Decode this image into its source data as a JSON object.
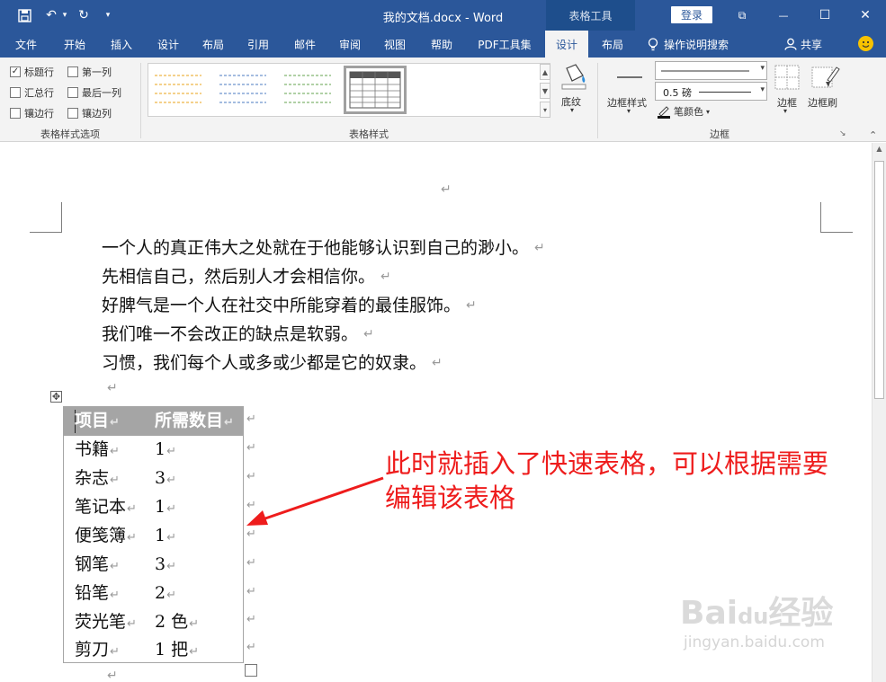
{
  "titlebar": {
    "title": "我的文档.docx - Word",
    "context_tab": "表格工具",
    "login": "登录",
    "undo_icon": "↶",
    "redo_icon": "↻",
    "qat_dropdown_icon": "▾",
    "minimize_icon": "—",
    "restore_icon": "☐",
    "close_icon": "✕",
    "ribbon_display_icon": "⧉"
  },
  "tabs": [
    "文件",
    "开始",
    "插入",
    "设计",
    "布局",
    "引用",
    "邮件",
    "审阅",
    "视图",
    "帮助",
    "PDF工具集",
    "设计",
    "布局"
  ],
  "active_tab_index": 11,
  "tell_me": "操作说明搜索",
  "share": "共享",
  "ribbon": {
    "style_options": {
      "label": "表格样式选项",
      "checkboxes": [
        {
          "label": "标题行",
          "checked": true
        },
        {
          "label": "第一列",
          "checked": false
        },
        {
          "label": "汇总行",
          "checked": false
        },
        {
          "label": "最后一列",
          "checked": false
        },
        {
          "label": "镶边行",
          "checked": false
        },
        {
          "label": "镶边列",
          "checked": false
        }
      ],
      "check_mark": "✓"
    },
    "table_styles": {
      "label": "表格样式",
      "shading": "底纹",
      "shading_arrow": "▾",
      "gallery_colors": [
        "#e8a317",
        "#4a78c2",
        "#63a34d",
        "#555555"
      ]
    },
    "borders": {
      "label": "边框",
      "border_styles": "边框样式",
      "border_styles_arrow": "▾",
      "line_weight": "0.5 磅",
      "pen_color": "笔颜色",
      "pen_color_arrow": "▾",
      "borders_btn": "边框",
      "borders_arrow": "▾",
      "border_painter": "边框刷",
      "dropdown_arrow": "▾",
      "launcher_icon": "↘"
    },
    "collapse_icon": "⌃"
  },
  "document": {
    "return_mark": "↵",
    "paragraphs": [
      "一个人的真正伟大之处就在于他能够认识到自己的渺小。",
      "先相信自己，然后别人才会相信你。",
      "好脾气是一个人在社交中所能穿着的最佳服饰。",
      "我们唯一不会改正的缺点是软弱。",
      "习惯，我们每个人或多或少都是它的奴隶。"
    ],
    "table_move_icon": "✥",
    "table": {
      "headers": [
        "项目",
        "所需数目"
      ],
      "rows": [
        [
          "书籍",
          "1"
        ],
        [
          "杂志",
          "3"
        ],
        [
          "笔记本",
          "1"
        ],
        [
          "便笺簿",
          "1"
        ],
        [
          "钢笔",
          "3"
        ],
        [
          "铅笔",
          "2"
        ],
        [
          "荧光笔",
          "2 色"
        ],
        [
          "剪刀",
          "1 把"
        ]
      ]
    }
  },
  "annotation": {
    "line1": "此时就插入了快速表格，可以根据需要",
    "line2": "编辑该表格",
    "color": "#ee1c1c"
  },
  "watermark": {
    "brand": "Bai",
    "brand_tail": "经验",
    "paw": "du",
    "url": "jingyan.baidu.com"
  },
  "scrollbar": {
    "up_arrow": "▲"
  }
}
